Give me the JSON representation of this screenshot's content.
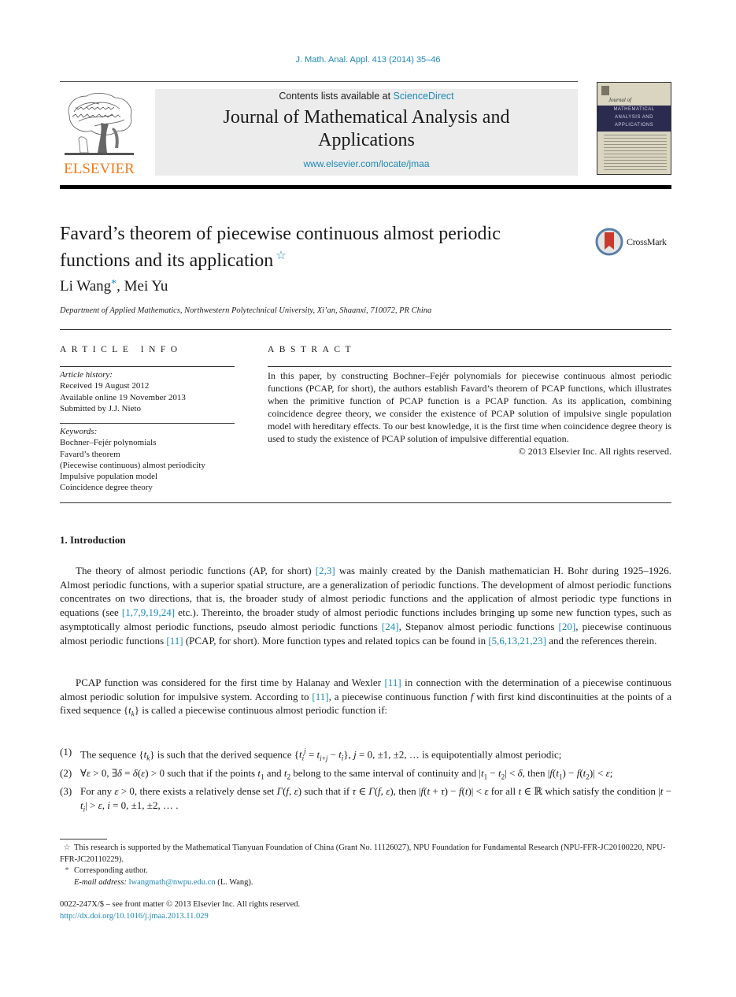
{
  "header": {
    "journal_ref": "J. Math. Anal. Appl. 413 (2014) 35–46",
    "publisher_logo_text": "ELSEVIER",
    "contents_prefix": "Contents lists available at ",
    "contents_link": "ScienceDirect",
    "journal_title_line1": "Journal of Mathematical Analysis and",
    "journal_title_line2": "Applications",
    "journal_url": "www.elsevier.com/locate/jmaa",
    "cover": {
      "journal_of": "Journal of",
      "band_lines": [
        "MATHEMATICAL",
        "ANALYSIS AND",
        "APPLICATIONS"
      ]
    }
  },
  "article": {
    "title": "Favard’s theorem of piecewise continuous almost periodic functions and its application",
    "title_note_mark": "☆",
    "crossmark_label": "CrossMark",
    "authors": [
      {
        "name": "Li Wang",
        "mark": "*"
      },
      {
        "name": "Mei Yu",
        "mark": ""
      }
    ],
    "author_separator": ", ",
    "affiliation": "Department of Applied Mathematics, Northwestern Polytechnical University, Xi’an, Shaanxi, 710072, PR China"
  },
  "article_info": {
    "heading": "ARTICLE INFO",
    "history_label": "Article history:",
    "history": [
      "Received 19 August 2012",
      "Available online 19 November 2013",
      "Submitted by J.J. Nieto"
    ],
    "keywords_label": "Keywords:",
    "keywords": [
      "Bochner–Fejér polynomials",
      "Favard’s theorem",
      "(Piecewise continuous) almost periodicity",
      "Impulsive population model",
      "Coincidence degree theory"
    ]
  },
  "abstract": {
    "heading": "ABSTRACT",
    "text": "In this paper, by constructing Bochner–Fejér polynomials for piecewise continuous almost periodic functions (PCAP, for short), the authors establish Favard’s theorem of PCAP functions, which illustrates when the primitive function of PCAP function is a PCAP function. As its application, combining coincidence degree theory, we consider the existence of PCAP solution of impulsive single population model with hereditary effects. To our best knowledge, it is the first time when coincidence degree theory is used to study the existence of PCAP solution of impulsive differential equation.",
    "copyright": "© 2013 Elsevier Inc. All rights reserved."
  },
  "introduction": {
    "heading": "1. Introduction",
    "para1": [
      {
        "t": "The theory of almost periodic functions (AP, for short) "
      },
      {
        "ref": "[2,3]"
      },
      {
        "t": " was mainly created by the Danish mathematician H. Bohr during 1925–1926. Almost periodic functions, with a superior spatial structure, are a generalization of periodic functions. The development of almost periodic functions concentrates on two directions, that is, the broader study of almost periodic functions and the application of almost periodic type functions in equations (see "
      },
      {
        "ref": "[1,7,9,19,24]"
      },
      {
        "t": " etc.). Thereinto, the broader study of almost periodic functions includes bringing up some new function types, such as asymptotically almost periodic functions, pseudo almost periodic functions "
      },
      {
        "ref": "[24]"
      },
      {
        "t": ", Stepanov almost periodic functions "
      },
      {
        "ref": "[20]"
      },
      {
        "t": ", piecewise continuous almost periodic functions "
      },
      {
        "ref": "[11]"
      },
      {
        "t": " (PCAP, for short). More function types and related topics can be found in "
      },
      {
        "ref": "[5,6,13,21,23]"
      },
      {
        "t": " and the references therein."
      }
    ],
    "para2": [
      {
        "t": "PCAP function was considered for the first time by Halanay and Wexler "
      },
      {
        "ref": "[11]"
      },
      {
        "t": " in connection with the determination of a piecewise continuous almost periodic solution for impulsive system. According to "
      },
      {
        "ref": "[11]"
      },
      {
        "t": ", a piecewise continuous function "
      },
      {
        "m": "f"
      },
      {
        "t": " with first kind discontinuities at the points of a fixed sequence {"
      },
      {
        "m": "t"
      },
      {
        "sub": "k"
      },
      {
        "t": "} is called a piecewise continuous almost periodic function if:"
      }
    ],
    "conditions": [
      {
        "num": "(1)",
        "text": "The sequence {t_k} is such that the derived sequence {t_i^j = t_{i+j} − t_i}, j = 0, ±1, ±2, … is equipotentially almost periodic;"
      },
      {
        "num": "(2)",
        "text": "∀ε > 0, ∃δ = δ(ε) > 0 such that if the points t₁ and t₂ belong to the same interval of continuity and |t₁ − t₂| < δ, then |f(t₁) − f(t₂)| < ε;"
      },
      {
        "num": "(3)",
        "text": "For any ε > 0, there exists a relatively dense set Γ(f, ε) such that if τ ∈ Γ(f, ε), then |f(t + τ) − f(t)| < ε for all t ∈ ℝ which satisfy the condition |t − t_i| > ε, i = 0, ±1, ±2, …."
      }
    ]
  },
  "footnotes": {
    "funding_mark": "☆",
    "funding": "This research is supported by the Mathematical Tianyuan Foundation of China (Grant No. 11126027), NPU Foundation for Fundamental Research (NPU-FFR-JC20100220, NPU-FFR-JC20110229).",
    "corresponding_mark": "*",
    "corresponding": "Corresponding author.",
    "email_label": "E-mail address:",
    "email": "lwangmath@nwpu.edu.cn",
    "email_suffix": " (L. Wang)."
  },
  "front_matter": {
    "issn_line": "0022-247X/$ – see front matter  © 2013 Elsevier Inc. All rights reserved.",
    "doi": "http://dx.doi.org/10.1016/j.jmaa.2013.11.029"
  },
  "colors": {
    "link": "#1e88b6",
    "elsevier_orange": "#f07d18",
    "masthead_bg": "#ececec"
  }
}
